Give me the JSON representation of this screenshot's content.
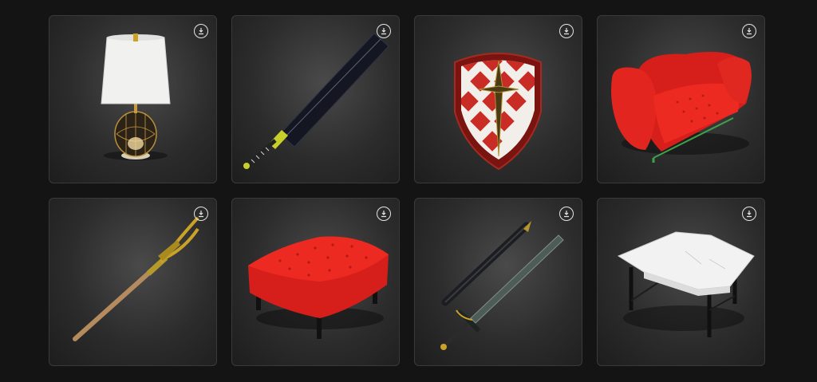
{
  "gallery": {
    "items": [
      {
        "name": "table-lamp"
      },
      {
        "name": "broad-sword"
      },
      {
        "name": "heraldic-shield"
      },
      {
        "name": "red-armchair"
      },
      {
        "name": "pitchfork"
      },
      {
        "name": "red-ottoman"
      },
      {
        "name": "sword-and-scabbard"
      },
      {
        "name": "marble-table"
      }
    ],
    "download_icon": "download-icon"
  },
  "colors": {
    "page_bg": "#141414",
    "card_border": "#3a3a3a",
    "icon": "#e6e6e6",
    "red": "#d9231d",
    "gold": "#c9a227"
  }
}
